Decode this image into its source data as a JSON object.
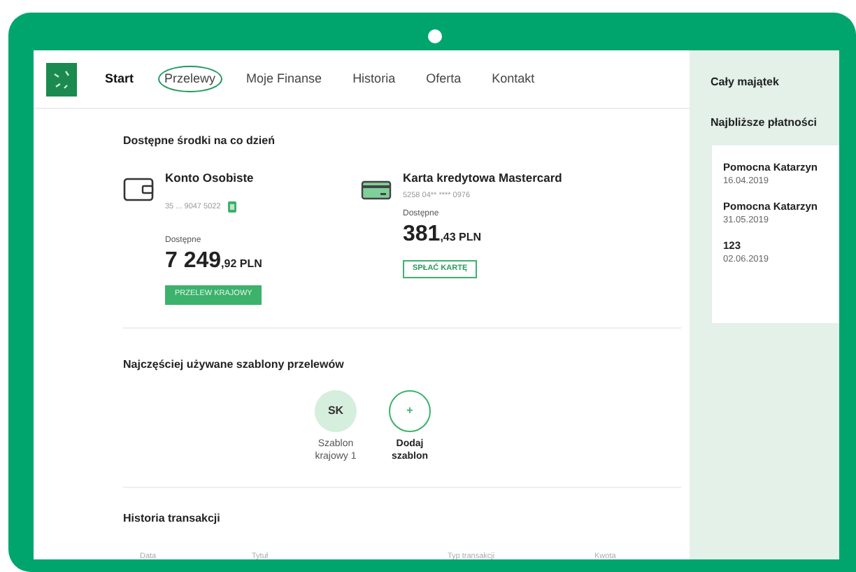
{
  "nav": {
    "items": [
      {
        "label": "Start",
        "selected": false,
        "bold": true
      },
      {
        "label": "Przelewy",
        "selected": true,
        "bold": false
      },
      {
        "label": "Moje Finanse",
        "selected": false,
        "bold": false
      },
      {
        "label": "Historia",
        "selected": false,
        "bold": false
      },
      {
        "label": "Oferta",
        "selected": false,
        "bold": false
      },
      {
        "label": "Kontakt",
        "selected": false,
        "bold": false
      }
    ]
  },
  "available_funds": {
    "title": "Dostępne środki na co dzień",
    "accounts": [
      {
        "kind": "wallet",
        "name": "Konto Osobiste",
        "number": "35 ... 9047 5022",
        "copy": true,
        "available_label": "Dostępne",
        "amount_int": "7 249",
        "amount_dec": ",92 PLN",
        "button": "PRZELEW KRAJOWY",
        "button_filled": true
      },
      {
        "kind": "card",
        "name": "Karta kredytowa Mastercard",
        "number": "5258 04** **** 0976",
        "copy": false,
        "available_label": "Dostępne",
        "amount_int": "381",
        "amount_dec": ",43 PLN",
        "button": "SPŁAĆ KARTĘ",
        "button_filled": false
      }
    ]
  },
  "templates": {
    "title": "Najczęściej używane szablony przelewów",
    "items": [
      {
        "kind": "template",
        "initials": "SK",
        "label": "Szablon krajowy 1"
      },
      {
        "kind": "add",
        "initials": "+",
        "label": "Dodaj szablon"
      }
    ]
  },
  "history": {
    "title": "Historia transakcji",
    "columns": [
      "Data",
      "Tytuł",
      "Typ transakcji",
      "Kwota"
    ]
  },
  "sidebar": {
    "total_assets": "Cały majątek",
    "upcoming_title": "Najbliższe płatności",
    "payments": [
      {
        "name": "Pomocna Katarzyn",
        "date": "16.04.2019"
      },
      {
        "name": "Pomocna Katarzyn",
        "date": "31.05.2019"
      },
      {
        "name": "123",
        "date": "02.06.2019"
      }
    ]
  }
}
